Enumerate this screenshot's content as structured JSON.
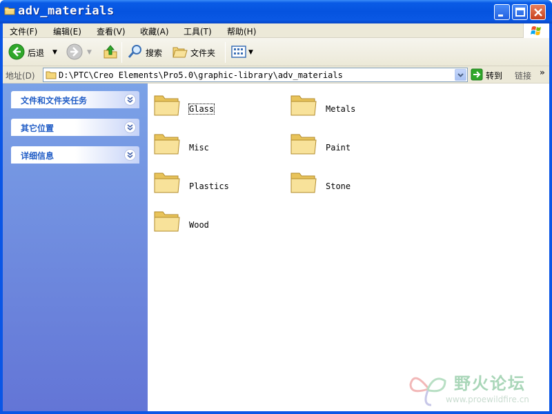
{
  "window": {
    "title": "adv_materials"
  },
  "menubar": {
    "items": [
      "文件(F)",
      "编辑(E)",
      "查看(V)",
      "收藏(A)",
      "工具(T)",
      "帮助(H)"
    ]
  },
  "toolbar": {
    "back_label": "后退",
    "search_label": "搜索",
    "folders_label": "文件夹"
  },
  "address": {
    "label": "地址(D)",
    "path": "D:\\PTC\\Creo Elements\\Pro5.0\\graphic-library\\adv_materials",
    "go_label": "转到",
    "links_label": "链接"
  },
  "tasks": {
    "items": [
      "文件和文件夹任务",
      "其它位置",
      "详细信息"
    ]
  },
  "folders": {
    "items": [
      "Glass",
      "Metals",
      "Misc",
      "Paint",
      "Plastics",
      "Stone",
      "Wood"
    ],
    "selected": "Glass"
  },
  "watermark": {
    "text": "野火论坛",
    "url": "www.proewildfire.cn"
  },
  "colors": {
    "title_blue": "#0553df",
    "panel_top": "#7ba2e7",
    "panel_bottom": "#6375d6",
    "task_text": "#215dc6",
    "folder_yellow": "#f5d77a",
    "menu_bg": "#ece9d8"
  }
}
